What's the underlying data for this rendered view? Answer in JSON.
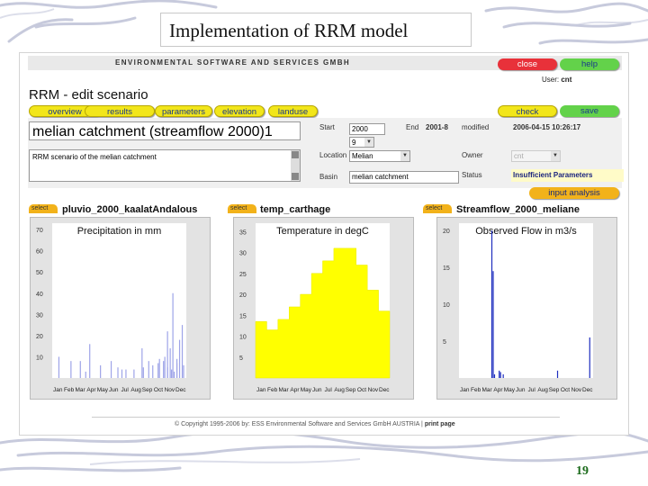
{
  "slide": {
    "title": "Implementation of RRM model",
    "number": "19"
  },
  "app": {
    "company": "Environmental Software and Services GmbH",
    "buttons": {
      "close": "close",
      "help": "help",
      "check": "check",
      "save": "save",
      "input_analysis": "input analysis"
    },
    "user_label": "User:",
    "user_value": "cnt",
    "page_title": "RRM - edit scenario",
    "tabs": [
      "overview",
      "results",
      "parameters",
      "elevation",
      "landuse"
    ],
    "scenario_name": "melian catchment (streamflow 2000)1",
    "description": "RRM scenario of the melian catchment",
    "fields": {
      "start_label": "Start",
      "start_value": "2000",
      "end_label": "End",
      "end_value": "2001-8",
      "modified_label": "modified",
      "modified_value": "2006-04-15 10:26:17",
      "start_month": "9",
      "location_label": "Location",
      "location_value": "Melian",
      "owner_label": "Owner",
      "owner_value": "cnt",
      "basin_label": "Basin",
      "basin_value": "melian catchment",
      "status_label": "Status",
      "status_value": "Insufficient Parameters"
    },
    "select_label": "select",
    "footer_copyright": "© Copyright 1995-2006 by:  ESS  Environmental Software and Services GmbH AUSTRIA",
    "footer_separator": "|",
    "footer_print": "print page"
  },
  "colors": {
    "accent_yellow": "#f2e61a",
    "tag_orange": "#f2b21a",
    "close_red": "#e8313a",
    "help_green": "#63d24a",
    "chart_bg": "#e3e3e3",
    "series_blue": "#1f2fbf",
    "temp_yellow": "#ffff00"
  },
  "chart_data": [
    {
      "type": "bar",
      "series_title": "pluvio_2000_kaalatAndalous",
      "title": "Precipitation in mm",
      "categories": [
        "Jan",
        "Feb",
        "Mar",
        "Apr",
        "May",
        "Jun",
        "Jul",
        "Aug",
        "Sep",
        "Oct",
        "Nov",
        "Dec"
      ],
      "yticks": [
        10,
        20,
        30,
        40,
        50,
        60,
        70
      ],
      "ylim": [
        0,
        73
      ],
      "x": [
        0.05,
        0.14,
        0.21,
        0.28,
        0.36,
        0.44,
        0.49,
        0.55,
        0.61,
        0.67,
        0.72,
        0.75,
        0.79,
        0.83,
        0.86,
        0.88,
        0.9,
        0.93,
        0.95,
        0.97,
        0.98,
        0.25,
        0.52,
        0.68,
        0.8,
        0.84,
        0.91,
        0.89,
        0.93,
        0.86
      ],
      "values": [
        10,
        8,
        8,
        16,
        6,
        8,
        5,
        4,
        4,
        14,
        8,
        6,
        7,
        8,
        5,
        14,
        40,
        9,
        18,
        25,
        6,
        3,
        4,
        5,
        9,
        10,
        3,
        4,
        7,
        22
      ]
    },
    {
      "type": "bar",
      "series_title": "temp_carthage",
      "title": "Temperature in degC",
      "categories": [
        "Jan",
        "Feb",
        "Mar",
        "Apr",
        "May",
        "Jun",
        "Jul",
        "Aug",
        "Sep",
        "Oct",
        "Nov",
        "Dec"
      ],
      "yticks": [
        5,
        10,
        15,
        20,
        25,
        30,
        35
      ],
      "ylim": [
        0,
        37
      ],
      "values": [
        13.5,
        11.5,
        14,
        17,
        20,
        25,
        28,
        31,
        31,
        27,
        21,
        16
      ]
    },
    {
      "type": "bar",
      "series_title": "Streamflow_2000_meliane",
      "title": "Observed Flow in m3/s",
      "categories": [
        "Jan",
        "Feb",
        "Mar",
        "Apr",
        "May",
        "Jun",
        "Jul",
        "Aug",
        "Sep",
        "Oct",
        "Nov",
        "Dec"
      ],
      "yticks": [
        5,
        10,
        15,
        20
      ],
      "ylim": [
        0,
        21
      ],
      "x": [
        0.245,
        0.255,
        0.265,
        0.3,
        0.31,
        0.33,
        0.735,
        0.975
      ],
      "values": [
        20,
        14.5,
        0.5,
        1,
        0.8,
        0.5,
        1,
        5.5
      ]
    }
  ]
}
